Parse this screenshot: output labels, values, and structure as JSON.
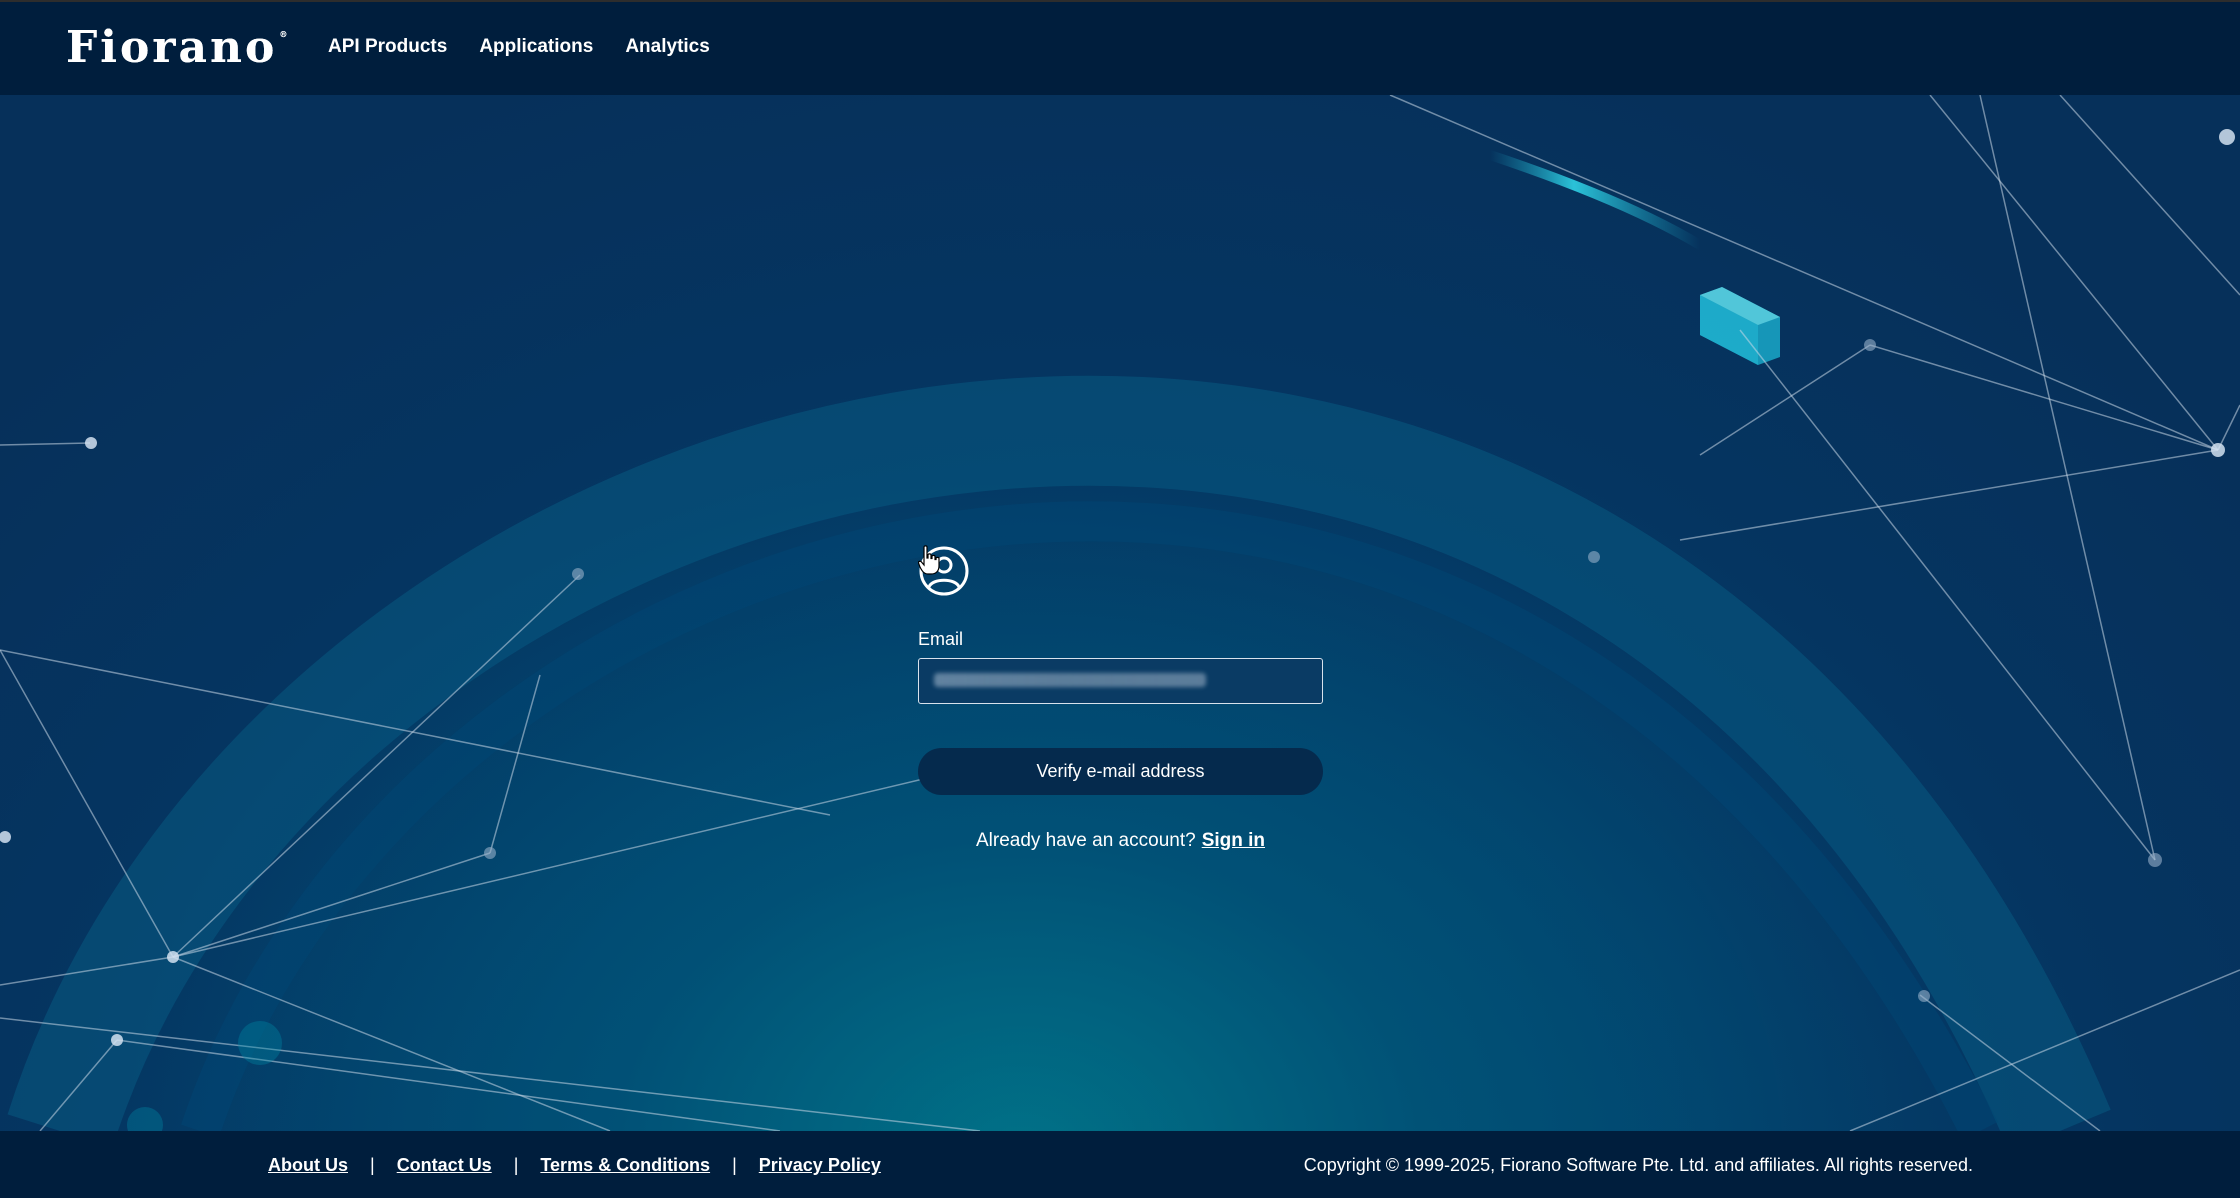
{
  "header": {
    "logo_text": "Fiorano",
    "logo_mark": "®",
    "nav": [
      {
        "label": "API Products"
      },
      {
        "label": "Applications"
      },
      {
        "label": "Analytics"
      }
    ]
  },
  "form": {
    "icon": "user-circle-icon",
    "email_label": "Email",
    "email_value": "",
    "verify_button_label": "Verify e-mail address",
    "signin_prompt": "Already have an account?",
    "signin_link": "Sign in"
  },
  "footer": {
    "links": [
      {
        "label": "About Us"
      },
      {
        "label": "Contact Us"
      },
      {
        "label": "Terms & Conditions"
      },
      {
        "label": "Privacy Policy"
      }
    ],
    "separator": "|",
    "copyright": "Copyright © 1999-2025, Fiorano Software Pte. Ltd. and affiliates. All rights reserved."
  },
  "colors": {
    "header_bg": "#001e3d",
    "button_bg": "#052a4d",
    "hero_bg": "#03506f"
  }
}
